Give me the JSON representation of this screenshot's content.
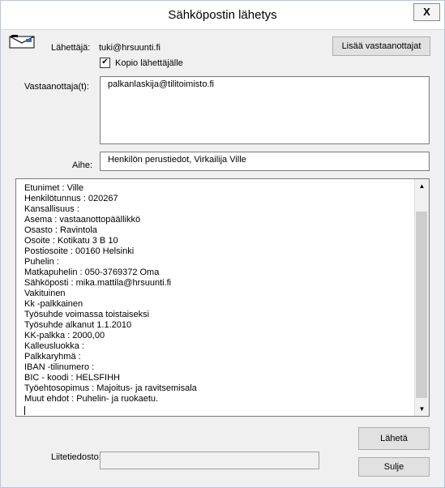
{
  "window": {
    "title": "Sähköpostin lähetys",
    "close_label": "X"
  },
  "sender": {
    "label": "Lähettäjä:",
    "value": "tuki@hrsuunti.fi"
  },
  "add_recipients_button": "Lisää vastaanottajat",
  "copy_to_sender": {
    "label": "Kopio lähettäjälle",
    "checked": true,
    "check_glyph": "✔"
  },
  "recipients": {
    "label": "Vastaanottaja(t):",
    "value": "palkanlaskija@tilitoimisto.fi"
  },
  "subject": {
    "label": "Aihe:",
    "value": "Henkilön perustiedot, Virkailija Ville"
  },
  "body_lines": [
    "Etunimet : Ville",
    "Henkilötunnus : 020267",
    "Kansallisuus :",
    "Asema : vastaanottopäällikkö",
    "Osasto : Ravintola",
    "Osoite : Kotikatu 3 B 10",
    "Postiosoite : 00160 Helsinki",
    "Puhelin :",
    "Matkapuhelin : 050-3769372 Oma",
    "Sähköposti : mika.mattila@hrsuunti.fi",
    "Vakituinen",
    "Kk -palkkainen",
    "Työsuhde voimassa toistaiseksi",
    "Työsuhde alkanut 1.1.2010",
    "KK-palkka : 2000,00",
    "Kalleusluokka :",
    "Palkkaryhmä :",
    "IBAN -tilinumero :",
    "BIC - koodi : HELSFIHH",
    "Työehtosopimus : Majoitus- ja ravitsemisala",
    "Muut ehdot : Puhelin- ja ruokaetu."
  ],
  "attachments": {
    "label": "Liitetiedosto:",
    "value": ""
  },
  "send_button": "Lähetä",
  "close_button": "Sulje",
  "icons": {
    "mail": "envelope-icon",
    "scroll_up": "▲",
    "scroll_down": "▼"
  }
}
